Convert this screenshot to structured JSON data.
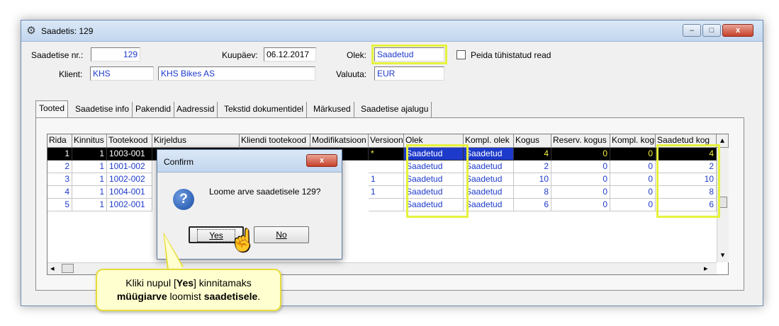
{
  "window": {
    "title": "Saadetis: 129",
    "btn_minimize": "–",
    "btn_maximize": "□",
    "btn_close": "x"
  },
  "form": {
    "shipment_no_label": "Saadetise nr.:",
    "shipment_no_value": "129",
    "date_label": "Kuupäev:",
    "date_value": "06.12.2017",
    "status_label": "Olek:",
    "status_value": "Saadetud",
    "hide_cancelled_label": "Peida tühistatud read",
    "client_label": "Klient:",
    "client_code": "KHS",
    "client_name": "KHS Bikes AS",
    "currency_label": "Valuuta:",
    "currency_value": "EUR"
  },
  "tabs": [
    "Tooted",
    "Saadetise info",
    "Pakendid",
    "Aadressid",
    "Tekstid dokumentidel",
    "Märkused",
    "Saadetise ajalugu"
  ],
  "grid": {
    "headers": [
      "Rida",
      "Kinnitus",
      "Tootekood",
      "Kirjeldus",
      "Kliendi tootekood",
      "Modifikatsioon",
      "Versioon",
      "Olek",
      "Kompl. olek",
      "Kogus",
      "Reserv. kogus",
      "Kompl. kogus",
      "Saadetud kog"
    ],
    "rows": [
      {
        "rida": "1",
        "kinnitus": "1",
        "tootekood": "1003-001",
        "versioon": "*",
        "olek": "Saadetud",
        "kompl_olek": "Saadetud",
        "kogus": "4",
        "reserv": "0",
        "kompl": "0",
        "saadetud": "4"
      },
      {
        "rida": "2",
        "kinnitus": "1",
        "tootekood": "1001-002",
        "versioon": "",
        "olek": "Saadetud",
        "kompl_olek": "Saadetud",
        "kogus": "2",
        "reserv": "0",
        "kompl": "0",
        "saadetud": "2"
      },
      {
        "rida": "3",
        "kinnitus": "1",
        "tootekood": "1002-002",
        "versioon": "1",
        "olek": "Saadetud",
        "kompl_olek": "Saadetud",
        "kogus": "10",
        "reserv": "0",
        "kompl": "0",
        "saadetud": "10"
      },
      {
        "rida": "4",
        "kinnitus": "1",
        "tootekood": "1004-001",
        "versioon": "1",
        "olek": "Saadetud",
        "kompl_olek": "Saadetud",
        "kogus": "8",
        "reserv": "0",
        "kompl": "0",
        "saadetud": "8"
      },
      {
        "rida": "5",
        "kinnitus": "1",
        "tootekood": "1002-001",
        "versioon": "",
        "olek": "Saadetud",
        "kompl_olek": "Saadetud",
        "kogus": "6",
        "reserv": "0",
        "kompl": "0",
        "saadetud": "6"
      }
    ]
  },
  "dialog": {
    "title": "Confirm",
    "close": "x",
    "icon": "question-icon",
    "message": "Loome arve saadetisele 129?",
    "yes": "Yes",
    "no": "No"
  },
  "callout": {
    "part1": "Kliki nupul [",
    "part2": "Yes",
    "part3": "] kinnitamaks",
    "part4": "müügiarve",
    "part5": " loomist ",
    "part6": "saadetisele",
    "part7": "."
  },
  "colors": {
    "highlight": "#e6f23c",
    "link_blue": "#1d3acb",
    "callout_bg": "#ffffcf"
  }
}
